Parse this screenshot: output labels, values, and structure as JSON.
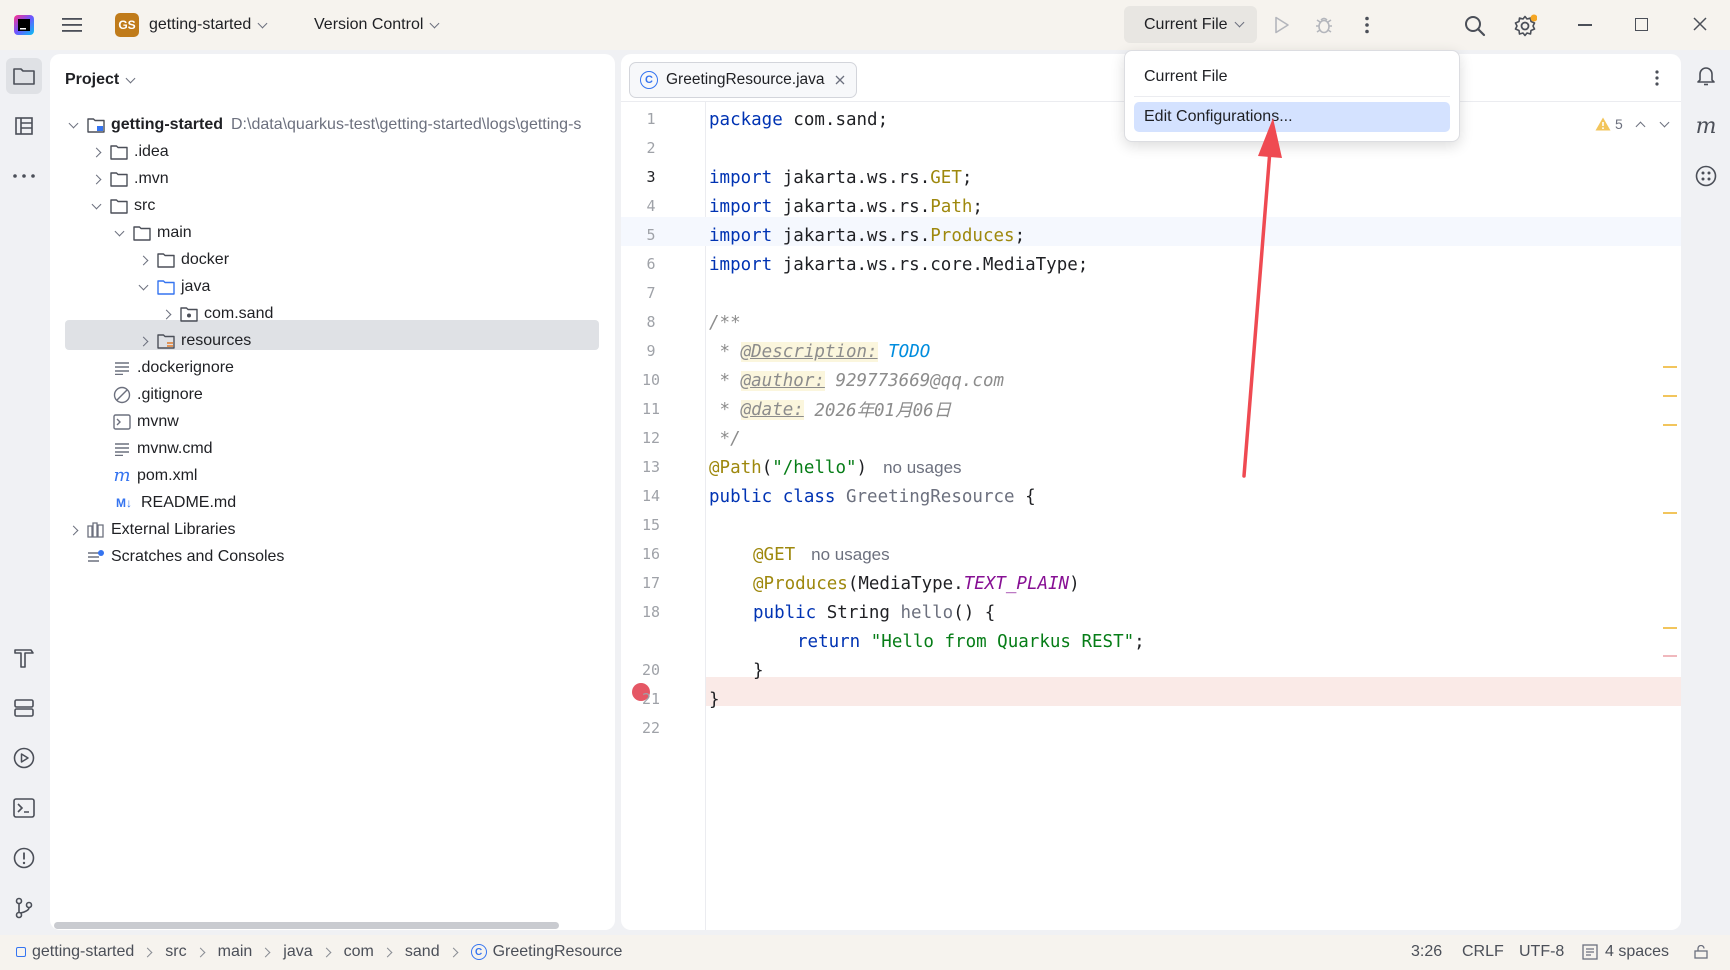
{
  "titlebar": {
    "project_badge": "GS",
    "project_name": "getting-started",
    "vcs_label": "Version Control",
    "run_config": "Current File"
  },
  "dropdown": {
    "items": [
      "Current File",
      "Edit Configurations..."
    ]
  },
  "project_panel": {
    "title": "Project",
    "root_name": "getting-started",
    "root_path": "D:\\data\\quarkus-test\\getting-started\\logs\\getting-s",
    "items": [
      ".idea",
      ".mvn",
      "src",
      "main",
      "docker",
      "java",
      "com.sand",
      "resources",
      ".dockerignore",
      ".gitignore",
      "mvnw",
      "mvnw.cmd",
      "pom.xml",
      "README.md",
      "External Libraries",
      "Scratches and Consoles"
    ]
  },
  "editor": {
    "tab_label": "GreetingResource.java",
    "warnings": "5",
    "line_numbers": [
      "1",
      "2",
      "3",
      "4",
      "5",
      "6",
      "7",
      "8",
      "9",
      "10",
      "11",
      "12",
      "13",
      "14",
      "15",
      "16",
      "17",
      "18",
      "",
      "20",
      "21",
      "22"
    ],
    "code": {
      "l1_kw": "package",
      "l1_rest": " com.sand;",
      "import_kw": "import",
      "l3_a": " jakarta.ws.rs.",
      "l3_b": "GET",
      "l3_c": ";",
      "l4_a": " jakarta.ws.rs.",
      "l4_b": "Path",
      "l4_c": ";",
      "l5_a": " jakarta.ws.rs.",
      "l5_b": "Produces",
      "l5_c": ";",
      "l6_a": " jakarta.ws.rs.core.MediaType;",
      "l8": "/**",
      "l9_a": " * ",
      "l9_tag": "@Description:",
      "l9_todo": "TODO",
      "l10_a": " * ",
      "l10_tag": "@author:",
      "l10_val": "929773669@qq.com",
      "l11_a": " * ",
      "l11_tag": "@date:",
      "l11_val": "2026年01月06日",
      "l12": " */",
      "l13_ann": "@Path",
      "l13_p1": "(",
      "l13_str": "\"/hello\"",
      "l13_p2": ")",
      "l13_hint": "no usages",
      "l14_kw": "public class",
      "l14_name": " GreetingResource",
      "l14_rest": " {",
      "l16_ann": "@GET",
      "l16_hint": "no usages",
      "l17_ann": "@Produces",
      "l17_a": "(MediaType.",
      "l17_b": "TEXT_PLAIN",
      "l17_c": ")",
      "l18_kw": "public",
      "l18_a": " String ",
      "l18_name": "hello",
      "l18_b": "() {",
      "l19_kw": "return",
      "l19_str": " \"Hello from Quarkus REST\"",
      "l19_c": ";",
      "l20": "}",
      "l21": "}"
    }
  },
  "statusbar": {
    "breadcrumbs": [
      "getting-started",
      "src",
      "main",
      "java",
      "com",
      "sand",
      "GreetingResource"
    ],
    "position": "3:26",
    "line_sep": "CRLF",
    "encoding": "UTF-8",
    "indent": "4 spaces"
  },
  "colors": {
    "accent": "#3574f0",
    "breakpoint": "#e55765",
    "annotation_arrow": "#ef4a52",
    "warning": "#f2c55c"
  }
}
